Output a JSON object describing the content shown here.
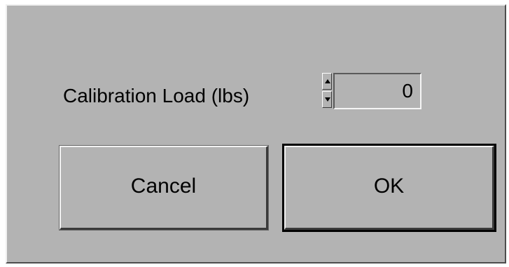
{
  "dialog": {
    "field": {
      "label": "Calibration Load (lbs)",
      "value": "0"
    },
    "buttons": {
      "cancel_label": "Cancel",
      "ok_label": "OK"
    }
  },
  "icons": {
    "spin_up": "triangle-up-icon",
    "spin_down": "triangle-down-icon"
  },
  "colors": {
    "panel_background": "#b3b3b3",
    "default_button_outline": "#000000"
  }
}
